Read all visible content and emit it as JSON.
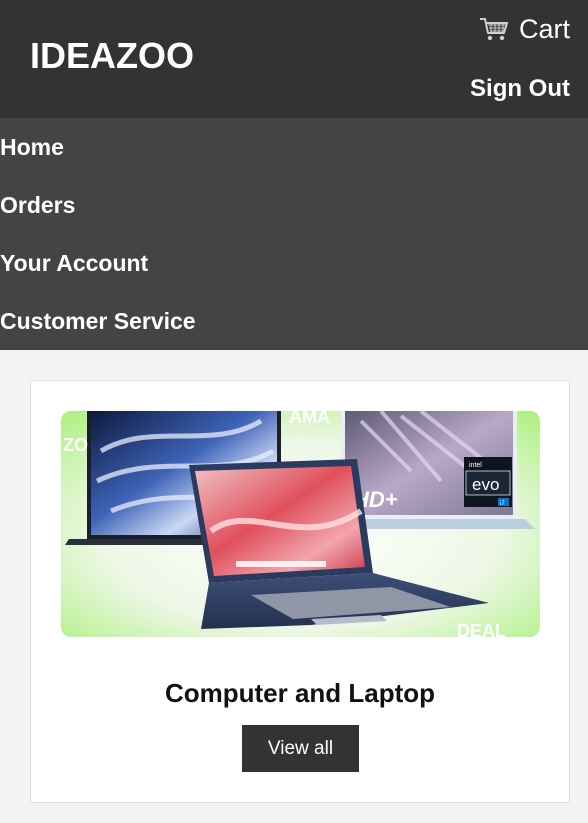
{
  "header": {
    "brand": "IDEAZOO",
    "cart_label": "Cart",
    "cart_icon": "cart-icon",
    "sign_out_label": "Sign Out"
  },
  "nav": {
    "items": [
      {
        "label": "Home"
      },
      {
        "label": "Orders"
      },
      {
        "label": "Your Account"
      },
      {
        "label": "Customer Service"
      }
    ]
  },
  "category_card": {
    "title": "Computer and Laptop",
    "button_label": "View all",
    "image": {
      "subject": "laptops",
      "printed_text": [
        "AMA",
        "ZO",
        "HD+",
        "intel",
        "evo",
        "i7",
        "DEAL"
      ]
    }
  },
  "colors": {
    "header_bg": "#333333",
    "nav_bg": "#444444",
    "page_bg": "#f3f3f3",
    "accent_green": "#b9f58a"
  }
}
